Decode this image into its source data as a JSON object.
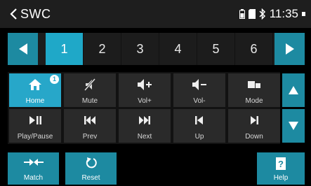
{
  "header": {
    "title": "SWC",
    "time": "11:35"
  },
  "pages": {
    "numbers": [
      "1",
      "2",
      "3",
      "4",
      "5",
      "6"
    ],
    "active": "1"
  },
  "keys": [
    {
      "label": "Home",
      "icon": "home-icon",
      "badge": "1",
      "active": true
    },
    {
      "label": "Mute",
      "icon": "mute-icon"
    },
    {
      "label": "Vol+",
      "icon": "volume-up-icon"
    },
    {
      "label": "Vol-",
      "icon": "volume-down-icon"
    },
    {
      "label": "Mode",
      "icon": "mode-icon"
    },
    {
      "label": "Play/Pause",
      "icon": "play-pause-icon"
    },
    {
      "label": "Prev",
      "icon": "previous-icon"
    },
    {
      "label": "Next",
      "icon": "next-icon"
    },
    {
      "label": "Up",
      "icon": "up-track-icon"
    },
    {
      "label": "Down",
      "icon": "down-track-icon"
    }
  ],
  "bottom": {
    "match": "Match",
    "reset": "Reset",
    "help": "Help"
  },
  "colors": {
    "accent": "#1d8aa1",
    "active": "#27a7c9",
    "key_bg": "#2a2a2a"
  }
}
